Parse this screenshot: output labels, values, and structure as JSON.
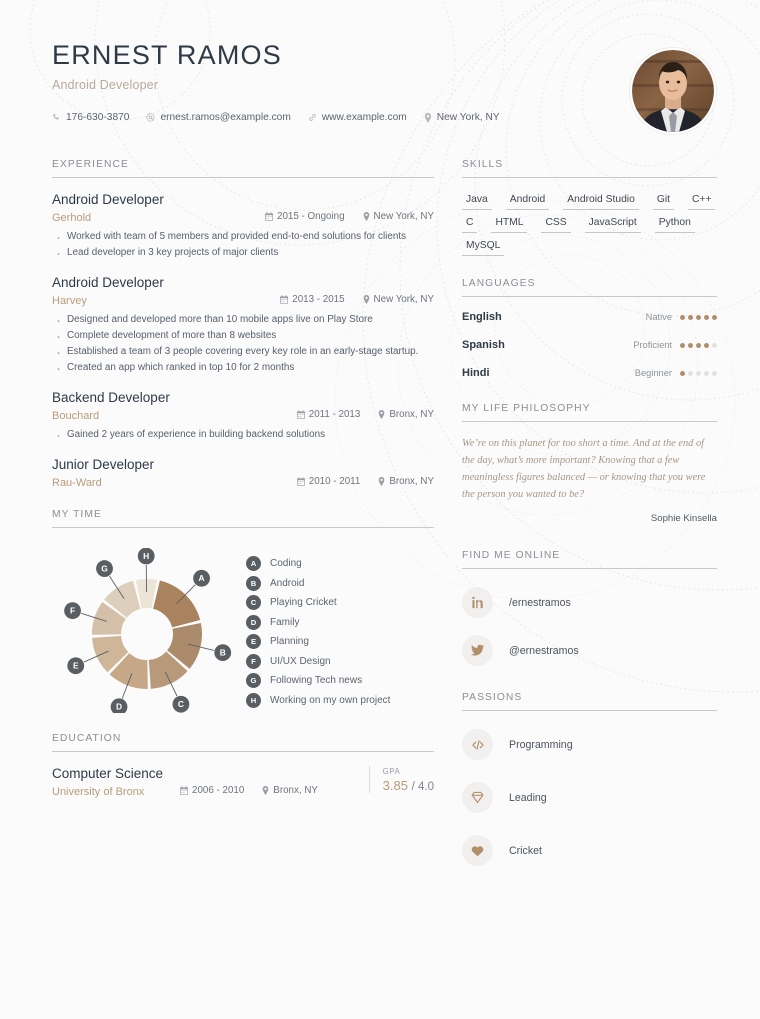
{
  "header": {
    "name": "ERNEST RAMOS",
    "job_title": "Android Developer",
    "contacts": [
      {
        "icon": "phone-icon",
        "text": "176-630-3870"
      },
      {
        "icon": "email-icon",
        "text": "ernest.ramos@example.com"
      },
      {
        "icon": "link-icon",
        "text": "www.example.com"
      },
      {
        "icon": "location-pin-icon",
        "text": "New York, NY"
      }
    ],
    "photo_alt": "portrait-photo"
  },
  "sections": {
    "experience_title": "EXPERIENCE",
    "my_time_title": "MY TIME",
    "education_title": "EDUCATION",
    "skills_title": "SKILLS",
    "languages_title": "LANGUAGES",
    "philosophy_title": "MY LIFE PHILOSOPHY",
    "online_title": "FIND ME ONLINE",
    "passions_title": "PASSIONS"
  },
  "experience": [
    {
      "role": "Android Developer",
      "company": "Gerhold",
      "dates": "2015 - Ongoing",
      "location": "New York, NY",
      "bullets": [
        "Worked with team of 5 members and provided end-to-end solutions for clients",
        "Lead developer in 3 key projects of major clients"
      ]
    },
    {
      "role": "Android Developer",
      "company": "Harvey",
      "dates": "2013 - 2015",
      "location": "New York, NY",
      "bullets": [
        "Designed and developed more than 10 mobile apps live on Play Store",
        "Complete development of more than 8 websites",
        "Established a team of 3 people covering every key role in an early-stage startup.",
        "Created an app which ranked in top 10 for 2 months"
      ]
    },
    {
      "role": "Backend Developer",
      "company": "Bouchard",
      "dates": "2011 - 2013",
      "location": "Bronx, NY",
      "bullets": [
        "Gained 2 years of experience in building backend solutions"
      ]
    },
    {
      "role": "Junior Developer",
      "company": "Rau-Ward",
      "dates": "2010 - 2011",
      "location": "Bronx, NY",
      "bullets": []
    }
  ],
  "education": [
    {
      "degree": "Computer Science",
      "school": "University of Bronx",
      "dates": "2006 - 2010",
      "location": "Bronx, NY",
      "gpa_label": "GPA",
      "gpa": "3.85",
      "gpa_scale": "/ 4.0"
    }
  ],
  "skills": [
    "Java",
    "Android",
    "Android Studio",
    "Git",
    "C++",
    "C",
    "HTML",
    "CSS",
    "JavaScript",
    "Python",
    "MySQL"
  ],
  "languages": [
    {
      "name": "English",
      "level": "Native",
      "rating": 5,
      "max": 5
    },
    {
      "name": "Spanish",
      "level": "Proficient",
      "rating": 4,
      "max": 5
    },
    {
      "name": "Hindi",
      "level": "Beginner",
      "rating": 1,
      "max": 5
    }
  ],
  "philosophy": {
    "quote": "We’re on this planet for too short a time. And at the end of the day, what’s more important? Knowing that a few meaningless figures balanced — or knowing that you were the person you wanted to be?",
    "author": "Sophie Kinsella"
  },
  "online": [
    {
      "icon": "linkedin-icon",
      "handle": "/ernestramos"
    },
    {
      "icon": "twitter-icon",
      "handle": "@ernestramos"
    }
  ],
  "passions": [
    {
      "icon": "code-icon",
      "label": "Programming"
    },
    {
      "icon": "diamond-icon",
      "label": "Leading"
    },
    {
      "icon": "heart-icon",
      "label": "Cricket"
    }
  ],
  "colors": {
    "accent": "#b08f6a",
    "heading": "#2e3a46",
    "muted": "#8a8f94",
    "rule": "#c9c9c9",
    "page_bg": "#fbfbfb"
  },
  "chart_data": {
    "type": "pie",
    "title": "MY TIME",
    "legend_position": "right",
    "categories": [
      "A",
      "B",
      "C",
      "D",
      "E",
      "F",
      "G",
      "H"
    ],
    "labels": [
      "Coding",
      "Android",
      "Playing Cricket",
      "Family",
      "Planning",
      "UI/UX Design",
      "Following Tech news",
      "Working on my own project"
    ],
    "values": [
      18,
      15,
      13,
      13,
      12,
      11,
      11,
      7
    ],
    "colors": [
      "#a8835e",
      "#ab8b6c",
      "#b8997a",
      "#c6a787",
      "#cfb698",
      "#d4c0a9",
      "#ddcfbc",
      "#ece4d7"
    ],
    "donut": true,
    "inner_radius_ratio": 0.48
  }
}
